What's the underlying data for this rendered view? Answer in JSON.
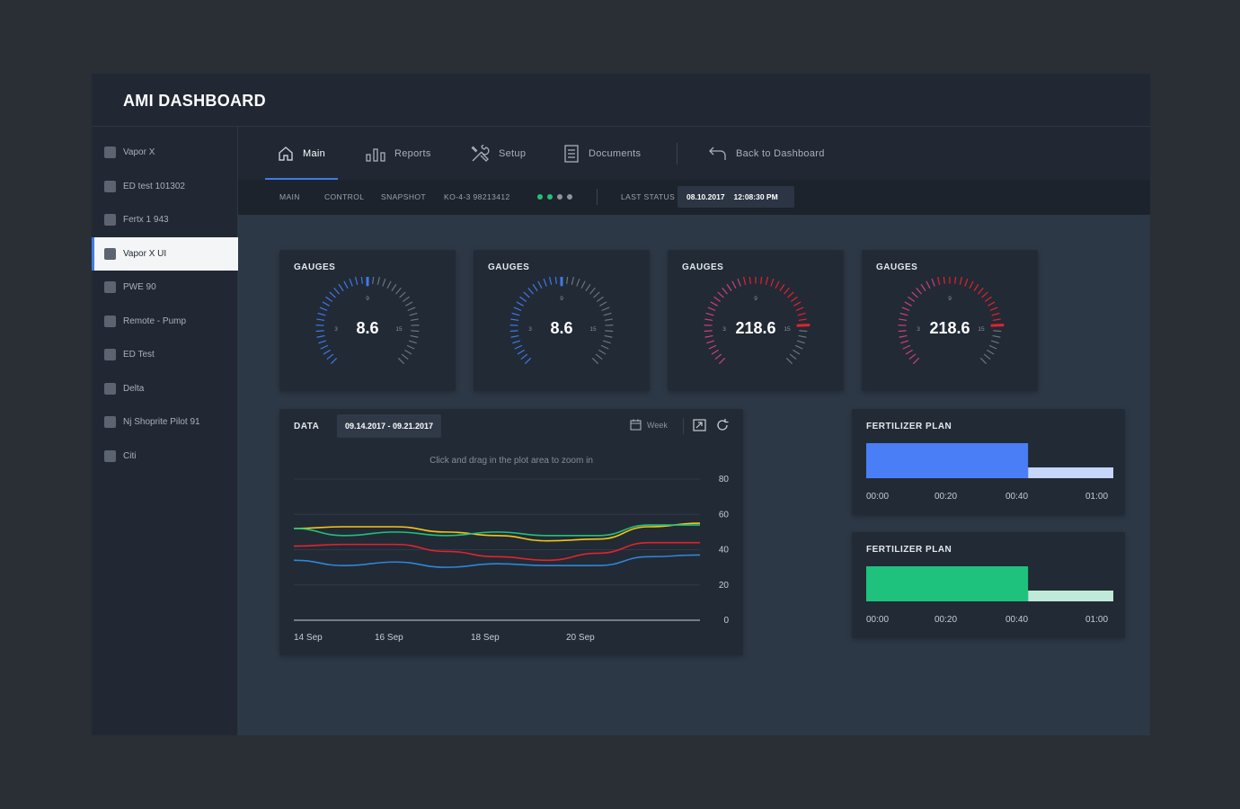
{
  "app": {
    "title": "AMI DASHBOARD"
  },
  "sidebar": {
    "items": [
      {
        "label": "Vapor X",
        "active": false
      },
      {
        "label": "ED test 101302",
        "active": false
      },
      {
        "label": "Fertx 1 943",
        "active": false
      },
      {
        "label": "Vapor X UI",
        "active": true
      },
      {
        "label": "PWE 90",
        "active": false
      },
      {
        "label": "Remote - Pump",
        "active": false
      },
      {
        "label": "ED Test",
        "active": false
      },
      {
        "label": "Delta",
        "active": false
      },
      {
        "label": "Nj Shoprite Pilot 91",
        "active": false
      },
      {
        "label": "Citi",
        "active": false
      }
    ]
  },
  "nav": {
    "tabs": [
      {
        "label": "Main",
        "icon": "home-icon",
        "active": true
      },
      {
        "label": "Reports",
        "icon": "bar-chart-icon",
        "active": false
      },
      {
        "label": "Setup",
        "icon": "tools-icon",
        "active": false
      },
      {
        "label": "Documents",
        "icon": "document-icon",
        "active": false
      }
    ],
    "back": {
      "label": "Back to Dashboard",
      "icon": "back-arrow-icon"
    }
  },
  "subnav": {
    "items": [
      "MAIN",
      "CONTROL",
      "SNAPSHOT",
      "KO-4-3  98213412"
    ],
    "dots": [
      "#22c07a",
      "#22c07a",
      "#8c94a0",
      "#8c94a0"
    ],
    "status_label": "LAST STATUS",
    "status_date": "08.10.2017",
    "status_time": "12:08:30 PM"
  },
  "gauges": [
    {
      "title": "GAUGES",
      "value": "8.6",
      "ticks": [
        "3",
        "9",
        "15"
      ],
      "theme": "blue",
      "needle": 9,
      "fill": 9
    },
    {
      "title": "GAUGES",
      "value": "8.6",
      "ticks": [
        "3",
        "9",
        "15"
      ],
      "theme": "blue",
      "needle": 9,
      "fill": 9
    },
    {
      "title": "GAUGES",
      "value": "218.6",
      "ticks": [
        "3",
        "9",
        "15"
      ],
      "theme": "red",
      "needle": 15,
      "fill": 15
    },
    {
      "title": "GAUGES",
      "value": "218.6",
      "ticks": [
        "3",
        "9",
        "15"
      ],
      "theme": "red",
      "needle": 15,
      "fill": 15
    }
  ],
  "colors": {
    "accent": "#3f7ae8",
    "gauge_blue": "#3f7ae8",
    "gauge_red": "#e2232f",
    "gauge_pink": "#c9437c"
  },
  "data_panel": {
    "title": "DATA",
    "date_range": "09.14.2017 - 09.21.2017",
    "period": "Week",
    "hint": "Click and drag in the plot area to zoom in"
  },
  "chart_data": {
    "type": "line",
    "x": [
      "14 Sep",
      "15 Sep",
      "16 Sep",
      "17 Sep",
      "18 Sep",
      "19 Sep",
      "20 Sep",
      "21 Sep"
    ],
    "x_tick_labels": [
      "14 Sep",
      "16 Sep",
      "18 Sep",
      "20 Sep"
    ],
    "yticks": [
      0,
      20,
      40,
      60,
      80
    ],
    "ylim": [
      0,
      80
    ],
    "series": [
      {
        "color": "#f5c518",
        "values": [
          52,
          53,
          53,
          50,
          48,
          45,
          46,
          53,
          55
        ]
      },
      {
        "color": "#22c07a",
        "values": [
          52,
          48,
          50,
          48,
          50,
          48,
          48,
          54,
          54
        ]
      },
      {
        "color": "#e2232f",
        "values": [
          42,
          43,
          43,
          39,
          36,
          34,
          38,
          44,
          44
        ]
      },
      {
        "color": "#2f86d6",
        "values": [
          34,
          31,
          33,
          30,
          32,
          31,
          31,
          36,
          37
        ]
      }
    ],
    "grid": true
  },
  "fertilizer": [
    {
      "title": "FERTILIZER PLAN",
      "bar_color": "#4a7ef7",
      "tail_color": "#c6d7fb",
      "progress": 0.655,
      "times": [
        "00:00",
        "00:20",
        "00:40",
        "01:00"
      ]
    },
    {
      "title": "FERTILIZER PLAN",
      "bar_color": "#1ec27d",
      "tail_color": "#bfead7",
      "progress": 0.655,
      "times": [
        "00:00",
        "00:20",
        "00:40",
        "01:00"
      ]
    }
  ]
}
